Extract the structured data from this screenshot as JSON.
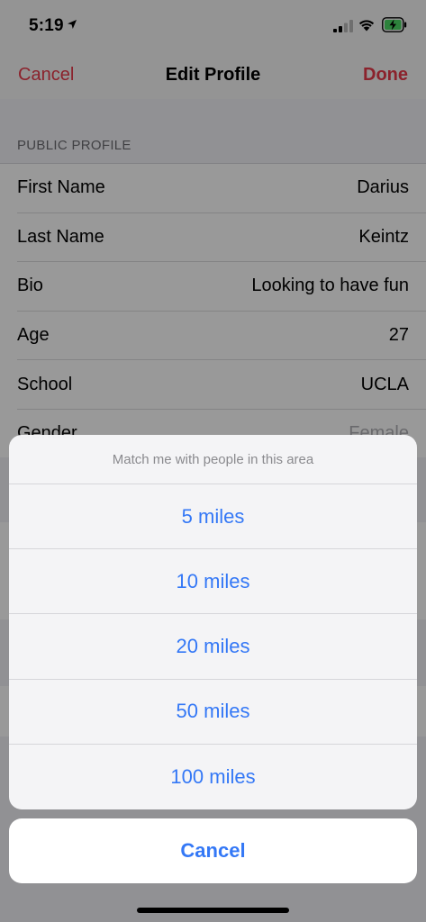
{
  "status": {
    "time": "5:19",
    "icons": [
      "location-arrow-icon",
      "cellular-signal-icon",
      "wifi-icon",
      "battery-charging-icon"
    ]
  },
  "nav": {
    "cancel_label": "Cancel",
    "title": "Edit Profile",
    "done_label": "Done",
    "accent_color": "#e8394a"
  },
  "profile": {
    "section_header": "PUBLIC PROFILE",
    "rows": [
      {
        "label": "First Name",
        "value": "Darius"
      },
      {
        "label": "Last Name",
        "value": "Keintz"
      },
      {
        "label": "Bio",
        "value": "Looking to have fun"
      },
      {
        "label": "Age",
        "value": "27"
      },
      {
        "label": "School",
        "value": "UCLA"
      },
      {
        "label": "Gender",
        "value": "Female"
      }
    ]
  },
  "action_sheet": {
    "title": "Match me with people in this area",
    "options": [
      "5 miles",
      "10 miles",
      "20 miles",
      "50 miles",
      "100 miles"
    ],
    "cancel_label": "Cancel",
    "option_color": "#3478f6"
  }
}
